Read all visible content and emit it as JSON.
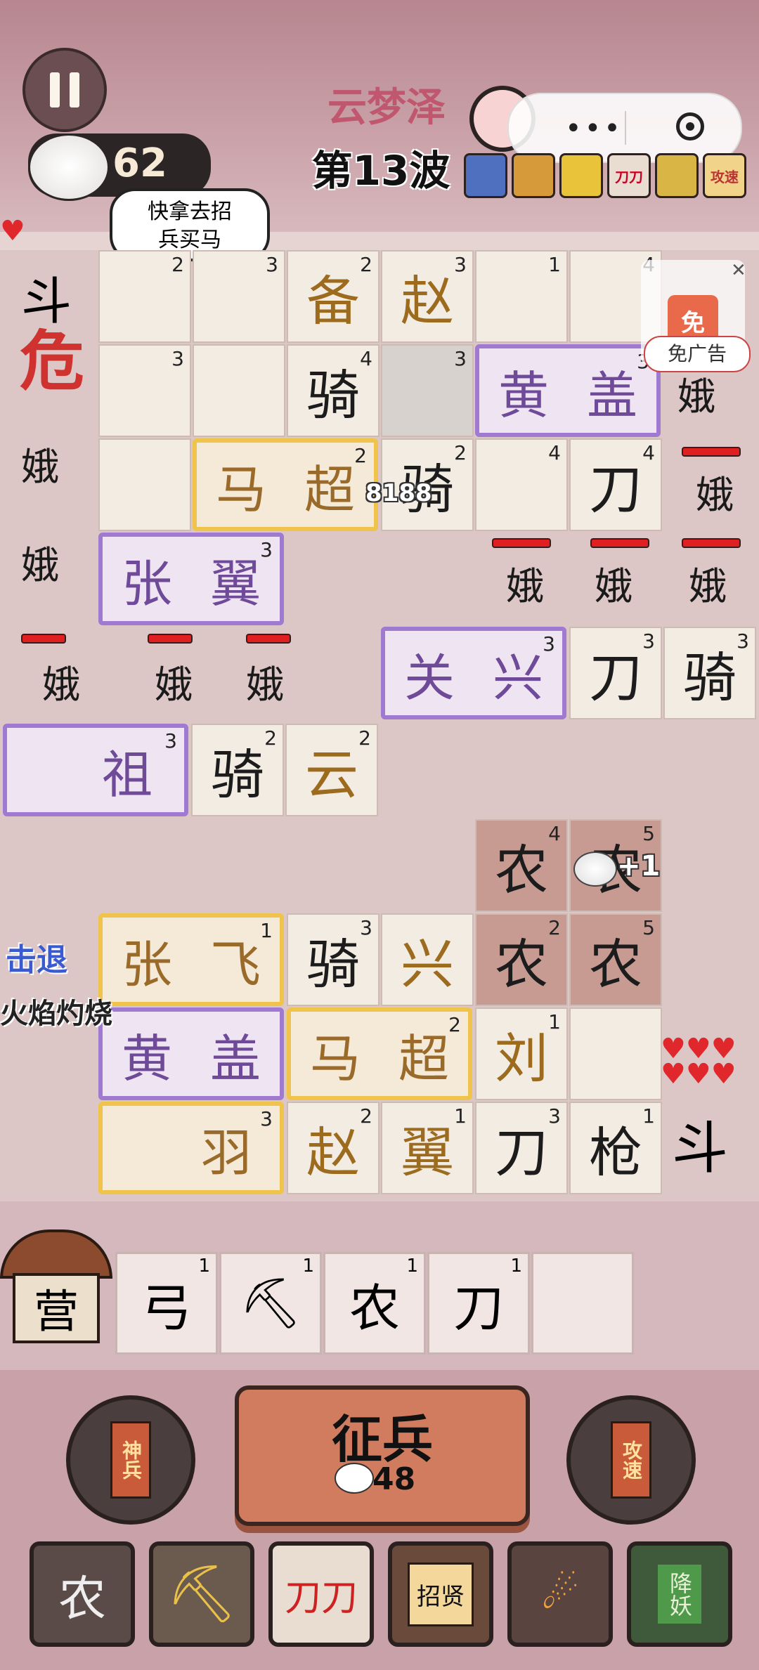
{
  "hud": {
    "level_name": "云梦泽",
    "wave": "第13波",
    "currency": "62",
    "speech": [
      "快拿去招",
      "兵买马"
    ],
    "buffs": [
      "",
      "",
      "",
      "刀刀",
      "",
      "攻速"
    ],
    "ad_badge": "免",
    "ad_label": "免广告",
    "colors": {
      "danger": "#d0322f",
      "gold_border": "#f0c44a",
      "purple_border": "#a07ad0"
    }
  },
  "board": {
    "danger_glyph": "危",
    "left_enemy": "斗",
    "right_enemy": "斗",
    "damage_number": "8188",
    "pickup": "+1",
    "effects": [
      "击退",
      "火焰灼烧"
    ],
    "cells": [
      {
        "t": "",
        "lv": "2"
      },
      {
        "t": "",
        "lv": "3"
      },
      {
        "t": "备",
        "lv": "2"
      },
      {
        "t": "赵",
        "lv": "3"
      },
      {
        "t": "",
        "lv": "1"
      },
      {
        "t": "",
        "lv": "4"
      },
      {
        "t": "",
        "lv": "3"
      },
      {
        "t": "",
        "lv": ""
      },
      {
        "t": "骑",
        "lv": "4"
      },
      {
        "t": "",
        "lv": "3"
      },
      {
        "t": "骑",
        "lv": "2"
      },
      {
        "t": "",
        "lv": "4"
      },
      {
        "t": "刀",
        "lv": "4"
      },
      {
        "t": "刀",
        "lv": "3"
      },
      {
        "t": "骑",
        "lv": "3"
      },
      {
        "t": "骑",
        "lv": "2"
      },
      {
        "t": "云",
        "lv": "2"
      },
      {
        "t": "农",
        "lv": "4"
      },
      {
        "t": "农",
        "lv": "5"
      },
      {
        "t": "骑",
        "lv": "3"
      },
      {
        "t": "兴",
        "lv": ""
      },
      {
        "t": "农",
        "lv": "2"
      },
      {
        "t": "农",
        "lv": "5"
      },
      {
        "t": "刘",
        "lv": "1"
      },
      {
        "t": "",
        "lv": ""
      },
      {
        "t": "赵",
        "lv": "2"
      },
      {
        "t": "翼",
        "lv": "1"
      },
      {
        "t": "刀",
        "lv": "3"
      },
      {
        "t": "枪",
        "lv": "1"
      }
    ],
    "heroes": [
      {
        "name": [
          "马",
          "超"
        ],
        "lv": "2"
      },
      {
        "name": [
          "黄",
          "盖"
        ],
        "lv": "3"
      },
      {
        "name": [
          "张",
          "翼"
        ],
        "lv": "3"
      },
      {
        "name": [
          "关",
          "兴"
        ],
        "lv": "3"
      },
      {
        "name": [
          "",
          "祖"
        ],
        "lv": "3"
      },
      {
        "name": [
          "张",
          "飞"
        ],
        "lv": "1"
      },
      {
        "name": [
          "黄",
          "盖"
        ],
        "lv": ""
      },
      {
        "name": [
          "马",
          "超"
        ],
        "lv": "2"
      },
      {
        "name": [
          "",
          "羽"
        ],
        "lv": "3"
      }
    ],
    "enemies": [
      "娥",
      "娥",
      "娥",
      "娥",
      "娥",
      "娥",
      "娥",
      "娥",
      "娥",
      "娥"
    ]
  },
  "camp": {
    "label": "营",
    "slots": [
      {
        "t": "弓",
        "lv": "1"
      },
      {
        "t": "",
        "lv": "1",
        "icon": "shovel-icon"
      },
      {
        "t": "农",
        "lv": "1"
      },
      {
        "t": "刀",
        "lv": "1"
      },
      {
        "t": "",
        "lv": ""
      }
    ]
  },
  "controls": {
    "recruit_label": "征兵",
    "recruit_cost": "48",
    "left_tag": "神兵",
    "right_tag": "攻速",
    "skills": [
      {
        "label": "农",
        "icon": "farmer-icon"
      },
      {
        "label": "",
        "icon": "shovel-icon"
      },
      {
        "label": "刀刀",
        "icon": "double-blade-icon"
      },
      {
        "label": "招贤",
        "icon": "scroll-icon"
      },
      {
        "label": "",
        "icon": "meteor-icon"
      },
      {
        "label": "降妖",
        "icon": "talisman-icon"
      }
    ]
  }
}
